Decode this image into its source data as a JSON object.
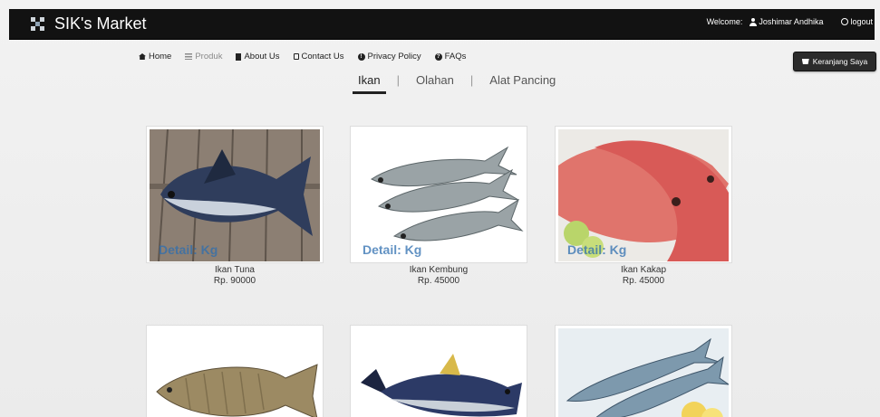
{
  "navbar": {
    "brand": "SIK's Market",
    "welcome_label": "Welcome:",
    "user_name": "Joshimar Andhika",
    "logout_label": "logout"
  },
  "menu": {
    "items": [
      {
        "label": "Home",
        "icon": "home-icon"
      },
      {
        "label": "Produk",
        "icon": "list-icon"
      },
      {
        "label": "About Us",
        "icon": "book-icon"
      },
      {
        "label": "Contact Us",
        "icon": "phone-icon"
      },
      {
        "label": "Privacy Policy",
        "icon": "info-icon"
      },
      {
        "label": "FAQs",
        "icon": "info-icon"
      }
    ]
  },
  "cart": {
    "label": "Keranjang Saya"
  },
  "tabs": [
    {
      "label": "Ikan"
    },
    {
      "label": "Olahan"
    },
    {
      "label": "Alat Pancing"
    }
  ],
  "products": [
    {
      "name": "Ikan Tuna",
      "price": "Rp. 90000",
      "detail": "Detail: Kg"
    },
    {
      "name": "Ikan Kembung",
      "price": "Rp. 45000",
      "detail": "Detail: Kg"
    },
    {
      "name": "Ikan Kakap",
      "price": "Rp. 45000",
      "detail": "Detail: Kg"
    },
    {
      "name": "",
      "price": ""
    },
    {
      "name": "",
      "price": ""
    },
    {
      "name": "",
      "price": ""
    }
  ],
  "colors": {
    "navbar_bg": "#121212",
    "detail_text": "#2d6eaf"
  }
}
